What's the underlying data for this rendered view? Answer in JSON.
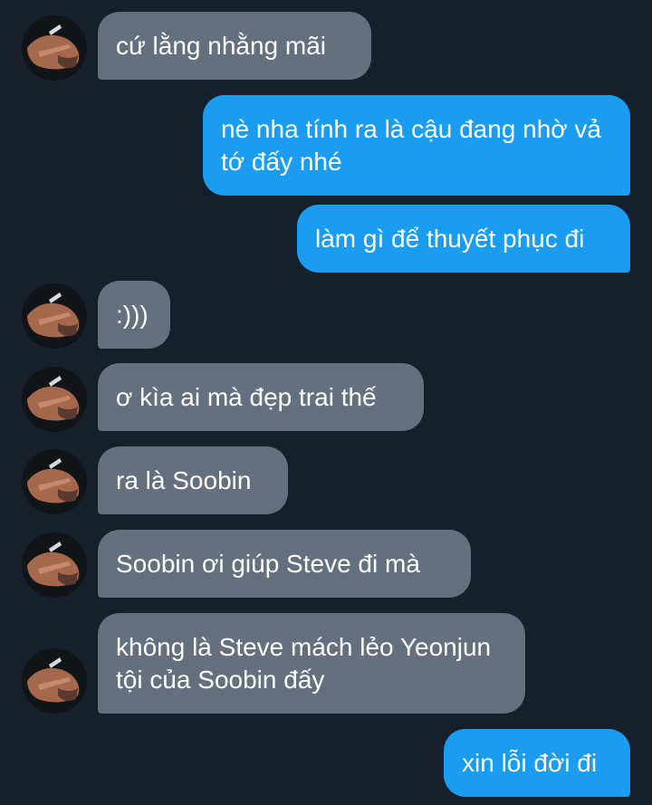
{
  "messages": [
    {
      "side": "incoming",
      "text": "cứ lằng nhằng mãi"
    },
    {
      "side": "outgoing",
      "text": "nè nha tính ra là cậu đang nhờ vả tớ đấy nhé"
    },
    {
      "side": "outgoing",
      "text": "làm gì để thuyết phục đi"
    },
    {
      "side": "incoming",
      "text": ":)))"
    },
    {
      "side": "incoming",
      "text": "ơ kìa ai mà đẹp trai thế"
    },
    {
      "side": "incoming",
      "text": "ra là Soobin"
    },
    {
      "side": "incoming",
      "text": "Soobin ơi giúp Steve đi mà"
    },
    {
      "side": "incoming",
      "text": "không là Steve mách lẻo Yeonjun tội của Soobin đấy"
    },
    {
      "side": "outgoing",
      "text": "xin lỗi đời đi"
    }
  ],
  "colors": {
    "background": "#16202c",
    "incoming_bubble": "#627080",
    "outgoing_bubble": "#1a9cf0",
    "text": "#ffffff"
  },
  "icons": {
    "avatar": "profile-photo-avatar"
  }
}
